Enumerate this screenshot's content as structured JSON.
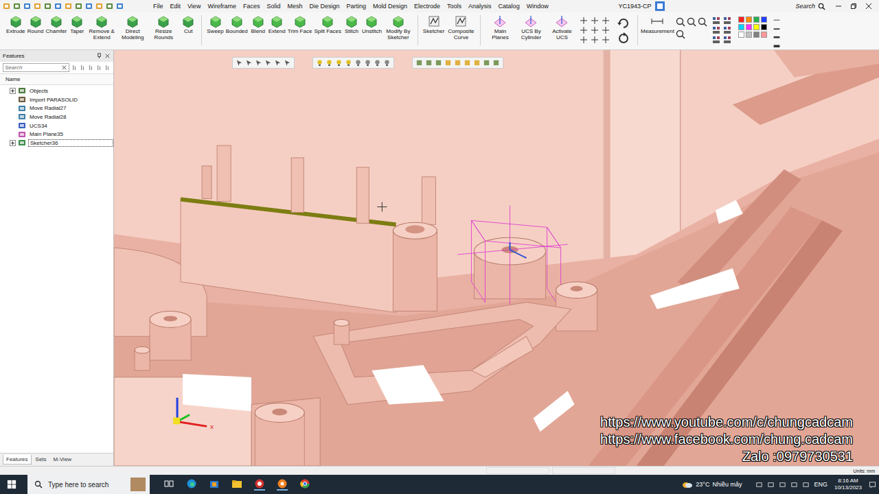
{
  "window": {
    "title": "YC1943-CP"
  },
  "menu": [
    "File",
    "Edit",
    "View",
    "Wireframe",
    "Faces",
    "Solid",
    "Mesh",
    "Die Design",
    "Parting",
    "Mold Design",
    "Electrode",
    "Tools",
    "Analysis",
    "Catalog",
    "Window"
  ],
  "search": {
    "label": "Search"
  },
  "ribbon": {
    "groups": [
      {
        "buttons": [
          "Extrude",
          "Round",
          "Chamfer",
          "Taper",
          "Remove & Extend",
          "Direct Modeling",
          "Resize Rounds",
          "Cut"
        ]
      },
      {
        "buttons": [
          "Sweep",
          "Bounded",
          "Blend",
          "Extend",
          "Trim Face",
          "Split Faces",
          "Stitch",
          "Unstitch",
          "Modify By Sketcher"
        ]
      },
      {
        "buttons": [
          "Sketcher",
          "Composite Curve"
        ]
      },
      {
        "buttons": [
          "Main Planes",
          "UCS By Cylinder",
          "Activate UCS"
        ]
      },
      {
        "buttons": [
          "Measurement"
        ]
      }
    ]
  },
  "palette": [
    {
      "color": "#ff2020"
    },
    {
      "color": "#ff8c00"
    },
    {
      "color": "#22b14c"
    },
    {
      "color": "#1f3fff"
    },
    {
      "color": "#00d0ff"
    },
    {
      "color": "#ff30ff"
    },
    {
      "color": "#ffff00"
    },
    {
      "color": "#000000"
    },
    {
      "color": "#ffffff"
    },
    {
      "color": "#c0c0c0"
    },
    {
      "color": "#808080"
    },
    {
      "color": "#ff9999"
    }
  ],
  "panel": {
    "title": "Features",
    "search_placeholder": "Search",
    "column": "Name",
    "items": [
      {
        "label": "Objects",
        "kind": "objects",
        "expandable": true,
        "expanded": false,
        "selected": false
      },
      {
        "label": "Import PARASOLID",
        "kind": "import",
        "expandable": false,
        "expanded": false,
        "selected": false
      },
      {
        "label": "Move Radial27",
        "kind": "move",
        "expandable": false,
        "expanded": false,
        "selected": false
      },
      {
        "label": "Move Radial28",
        "kind": "move",
        "expandable": false,
        "expanded": false,
        "selected": false
      },
      {
        "label": "UCS34",
        "kind": "ucs",
        "expandable": false,
        "expanded": false,
        "selected": false
      },
      {
        "label": "Main Plane35",
        "kind": "plane",
        "expandable": false,
        "expanded": false,
        "selected": false
      },
      {
        "label": "Sketcher36",
        "kind": "sketch",
        "expandable": true,
        "expanded": false,
        "selected": true
      }
    ],
    "tabs": [
      {
        "label": "Features",
        "selected": true
      },
      {
        "label": "Sets",
        "selected": false
      },
      {
        "label": "M-View",
        "selected": false
      }
    ]
  },
  "viewport": {
    "triad_label": "x",
    "watermarks": [
      "https://www.youtube.com/c/chungcadcam",
      "https://www.facebook.com/chung.cadcam",
      "Zalo :0979730531"
    ]
  },
  "status_bar": {
    "units": "Units: mm"
  },
  "taskbar": {
    "search_placeholder": "Type here to search",
    "temperature": "23°C",
    "weather": "Nhiều mây",
    "language": "ENG",
    "time": "8:16 AM",
    "date": "10/13/2023"
  }
}
